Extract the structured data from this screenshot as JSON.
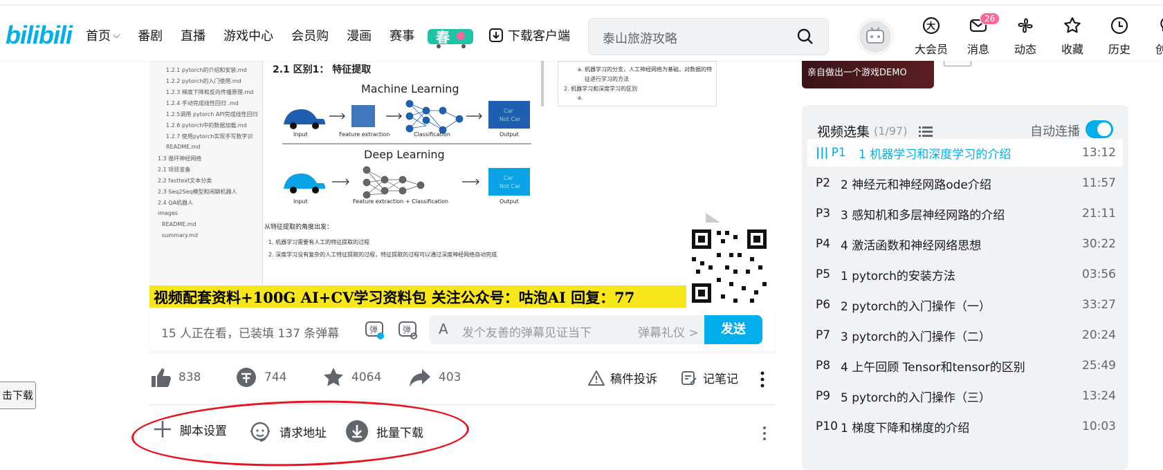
{
  "header": {
    "logo": "bilibili",
    "nav": [
      {
        "label": "首页"
      },
      {
        "label": "番剧"
      },
      {
        "label": "直播"
      },
      {
        "label": "游戏中心"
      },
      {
        "label": "会员购"
      },
      {
        "label": "漫画"
      },
      {
        "label": "赛事"
      }
    ],
    "spring_badge": "春",
    "download_client": "下载客户端",
    "search_placeholder": "泰山旅游攻略",
    "icons": [
      {
        "label": "大会员",
        "icon": "vip-icon"
      },
      {
        "label": "消息",
        "icon": "message-icon",
        "badge": "26"
      },
      {
        "label": "动态",
        "icon": "dynamic-icon"
      },
      {
        "label": "收藏",
        "icon": "star-icon"
      },
      {
        "label": "历史",
        "icon": "clock-icon"
      },
      {
        "label": "创作",
        "icon": "lightbulb-icon"
      }
    ]
  },
  "video": {
    "section_title": "2.1 区别1： 特征提取",
    "ml_title": "Machine Learning",
    "dl_title": "Deep Learning",
    "labels": {
      "input": "Input",
      "feature_extraction": "Feature extraction",
      "classification": "Classification",
      "output": "Output",
      "fe_cls": "Feature extraction + Classification",
      "car": "Car",
      "not_car": "Not Car"
    },
    "body_text": [
      "从特征提取的角度出发：",
      "1. 机器学习需要有人工的特征提取的过程",
      "2. 深度学习没有复杂的人工特征提取的过程，特征提取的过程可以通过深度神经网络自动完成"
    ],
    "right_notes": [
      "a. 机器学习的分支，人工神经网络为基础，对数据的特",
      "征进行学习的方法",
      "2. 机器学习和深度学习的区别",
      "a."
    ],
    "tree": [
      "1.2.1 pytorch的介绍和安装.md",
      "1.2.2 pytorch的入门使用.md",
      "1.2.3 梯度下降和反向传播原理.md",
      "1.2.4 手动完成线性回归 .md",
      "1.2.5调用 pytorch API完成线性回归",
      "1.2.6 pytorch中的数据加载.md",
      "1.2.7 使用pytorch实现手写数字识",
      "README.md",
      "1.3 循环神经网络",
      "2.1 项目准备",
      "2.2 fasttext文本分类",
      "2.3 Seq2Seq模型和闲聊机器人",
      "2.4 QA机器人",
      "images",
      "README.md",
      "summary.md"
    ],
    "subtitle": "视频配套资料+100G AI+CV学习资料包 关注公众号：咕泡AI 回复：77"
  },
  "danmaku": {
    "info": "15 人正在看，已装填 137 条弹幕",
    "placeholder": "发个友善的弹幕见证当下",
    "etiquette": "弹幕礼仪 >",
    "send": "发送"
  },
  "actions": {
    "like": "838",
    "coin": "744",
    "fav": "4064",
    "share": "403",
    "report": "稿件投诉",
    "notes": "记笔记"
  },
  "script_tools": {
    "settings": "脚本设置",
    "request": "请求地址",
    "batch": "批量下载"
  },
  "side_button": "击下载",
  "recommend": {
    "thumb_text": "亲自做出一个游戏DEMO"
  },
  "playlist": {
    "title": "视频选集",
    "count": "(1/97)",
    "autoplay": "自动连播",
    "episodes": [
      {
        "no": "P1",
        "title": "1 机器学习和深度学习的介绍",
        "dur": "13:12"
      },
      {
        "no": "P2",
        "title": "2 神经元和神经网路ode介绍",
        "dur": "11:57"
      },
      {
        "no": "P3",
        "title": "3 感知机和多层神经网路的介绍",
        "dur": "21:11"
      },
      {
        "no": "P4",
        "title": "4 激活函数和神经网络思想",
        "dur": "30:22"
      },
      {
        "no": "P5",
        "title": "1 pytorch的安装方法",
        "dur": "03:56"
      },
      {
        "no": "P6",
        "title": "2 pytorch的入门操作（一）",
        "dur": "33:27"
      },
      {
        "no": "P7",
        "title": "3 pytorch的入门操作（二）",
        "dur": "20:24"
      },
      {
        "no": "P8",
        "title": "4 上午回顾 Tensor和tensor的区别",
        "dur": "25:49"
      },
      {
        "no": "P9",
        "title": "5 pytorch的入门操作（三）",
        "dur": "13:24"
      },
      {
        "no": "P10",
        "title": "1 梯度下降和梯度的介绍",
        "dur": "10:03"
      }
    ]
  },
  "colors": {
    "brand": "#00aeec",
    "pink": "#ff6699",
    "annotation": "#e8131e",
    "subtitle_bg": "#f6e61a"
  }
}
